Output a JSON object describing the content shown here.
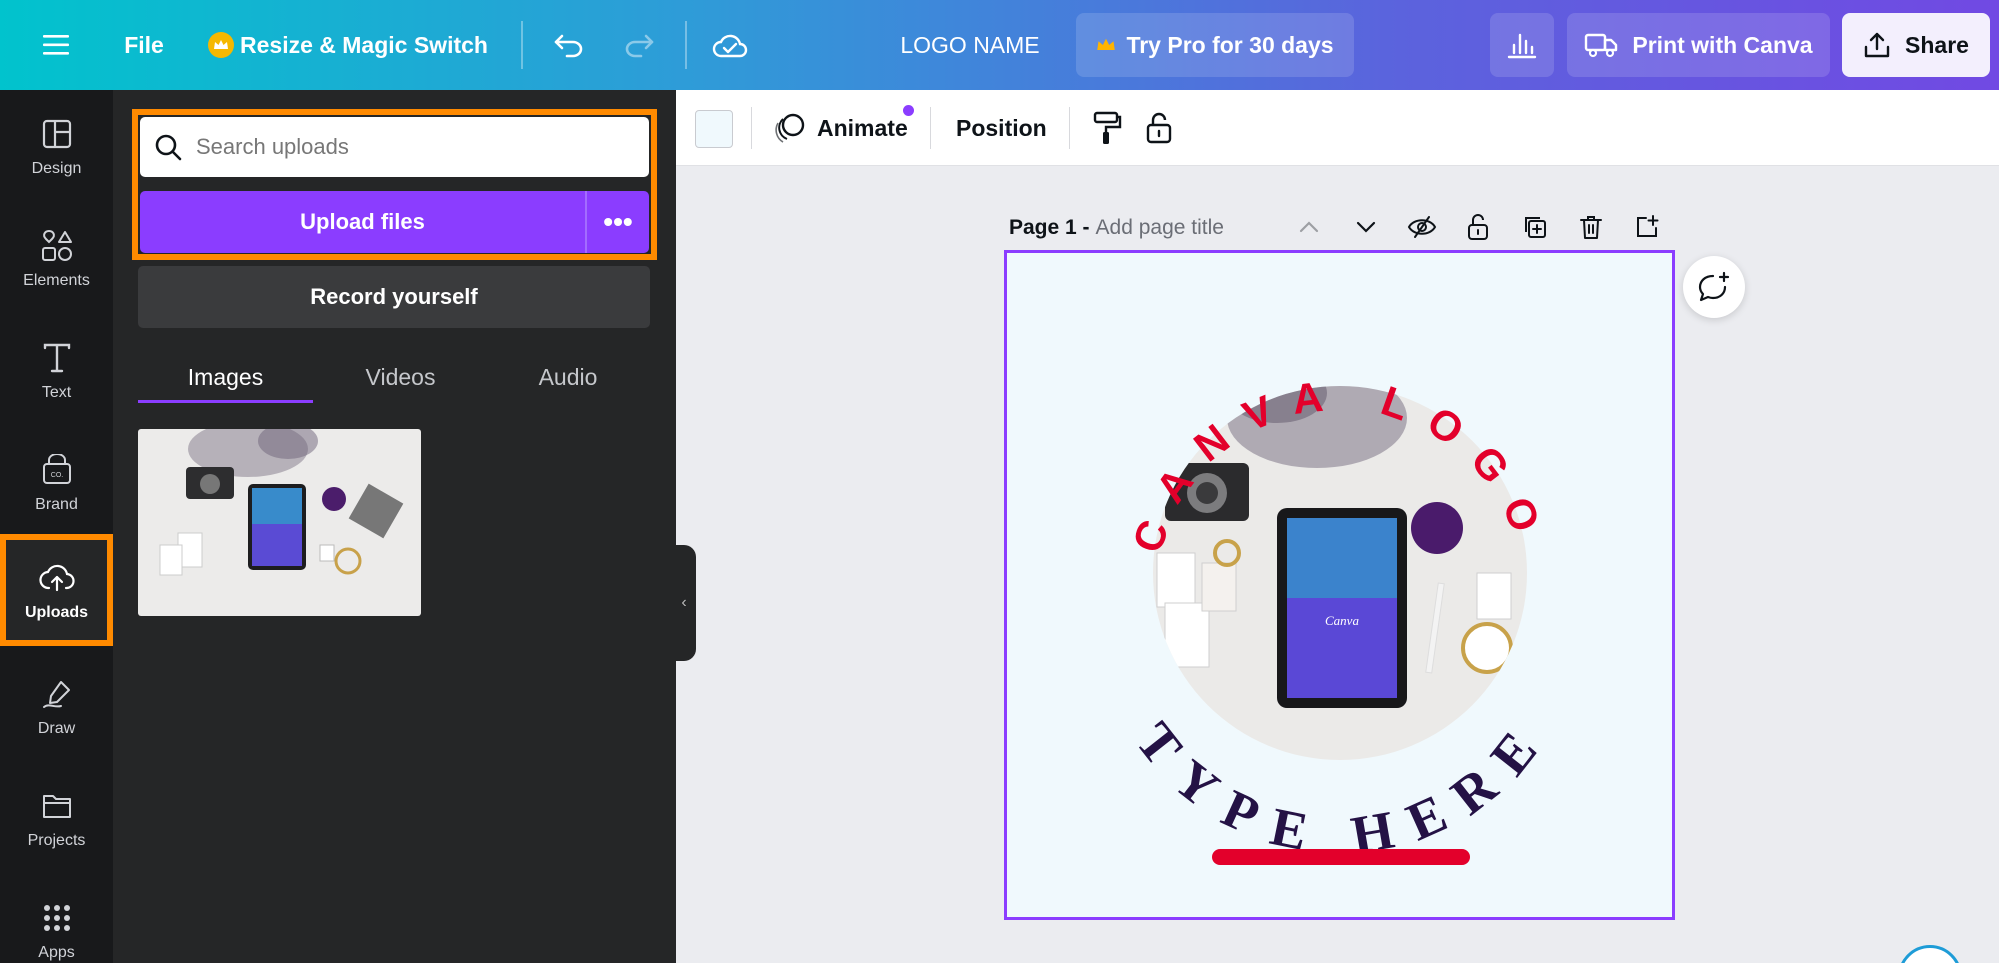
{
  "topbar": {
    "menu_icon": "hamburger-menu-icon",
    "file_label": "File",
    "resize_label": "Resize & Magic Switch",
    "logo_name": "LOGO NAME",
    "try_pro_label": "Try Pro for 30 days",
    "print_label": "Print with Canva",
    "share_label": "Share"
  },
  "rail": {
    "items": [
      {
        "label": "Design",
        "icon": "design-layout-icon"
      },
      {
        "label": "Elements",
        "icon": "elements-shapes-icon"
      },
      {
        "label": "Text",
        "icon": "text-t-icon"
      },
      {
        "label": "Brand",
        "icon": "brand-kit-icon"
      },
      {
        "label": "Uploads",
        "icon": "cloud-upload-icon",
        "active": true
      },
      {
        "label": "Draw",
        "icon": "draw-pen-icon"
      },
      {
        "label": "Projects",
        "icon": "folder-icon"
      },
      {
        "label": "Apps",
        "icon": "apps-grid-icon"
      }
    ]
  },
  "panel": {
    "search_placeholder": "Search uploads",
    "upload_label": "Upload files",
    "more_label": "•••",
    "record_label": "Record yourself",
    "tabs": [
      "Images",
      "Videos",
      "Audio"
    ],
    "active_tab": "Images"
  },
  "toolbar": {
    "animate_label": "Animate",
    "position_label": "Position"
  },
  "page": {
    "page_label": "Page 1 -",
    "title_placeholder": "Add page title"
  },
  "design": {
    "arc_top": "CANVA LOGO",
    "arc_bottom": "TYPE HERE",
    "tablet_text": "Canva",
    "top_color": "#e3002b",
    "bottom_color": "#241245",
    "bar_color": "#e3002b"
  },
  "colors": {
    "accent": "#8b3dff",
    "highlight": "#ff8a00"
  }
}
